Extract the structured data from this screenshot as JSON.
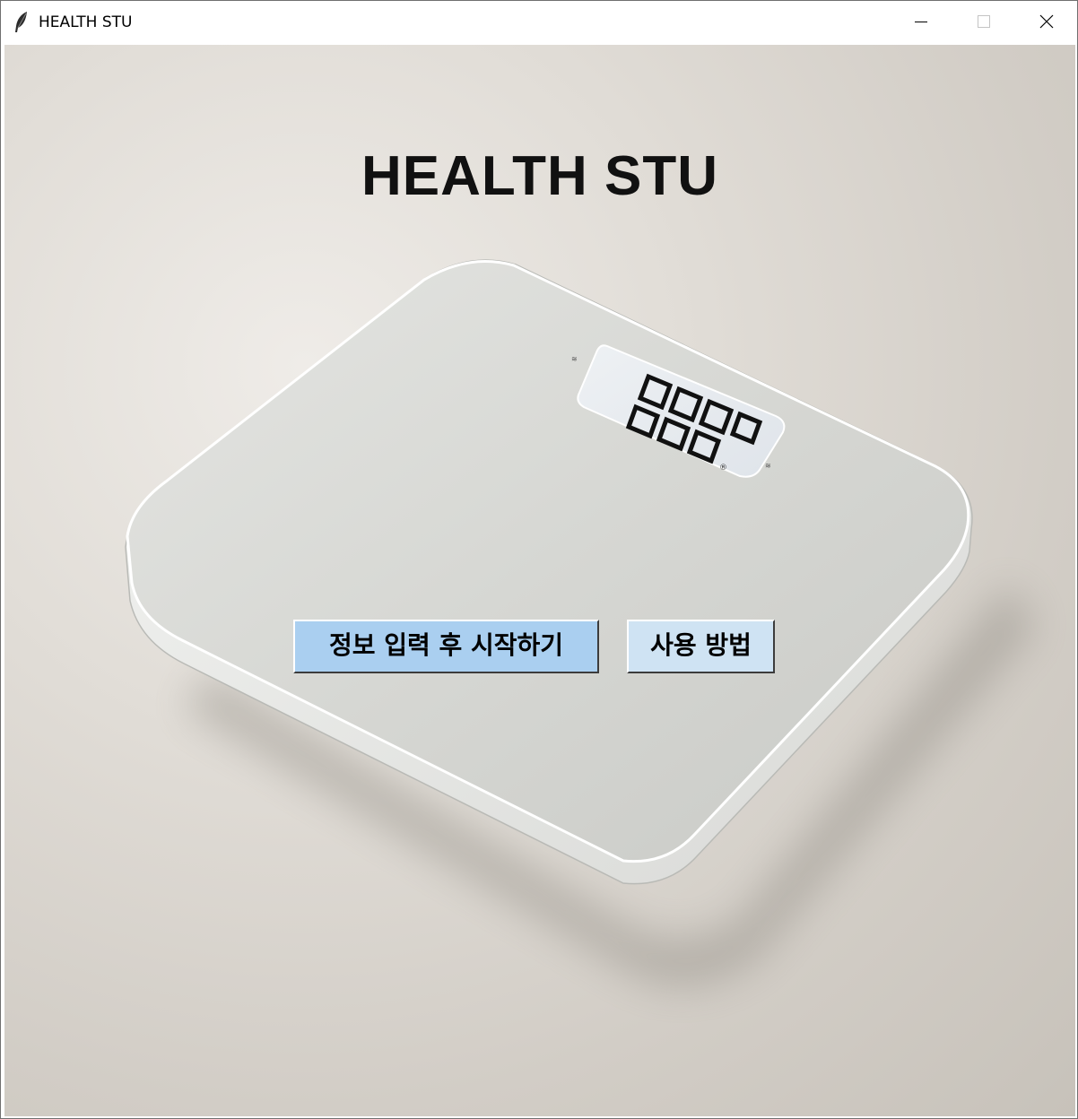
{
  "window": {
    "title": "HEALTH STU",
    "controls": {
      "minimize": "minimize-icon",
      "maximize": "maximize-icon",
      "close": "close-icon"
    }
  },
  "main": {
    "heading": "HEALTH STU",
    "background_image": "bathroom-scale-photo",
    "buttons": {
      "start_label": "정보 입력 후 시작하기",
      "help_label": "사용 방법"
    }
  },
  "colors": {
    "start_button_bg": "#aacff0",
    "help_button_bg": "#cfe3f3",
    "backdrop": "#d2cdc6",
    "scale_surface": "#d9dad6"
  }
}
